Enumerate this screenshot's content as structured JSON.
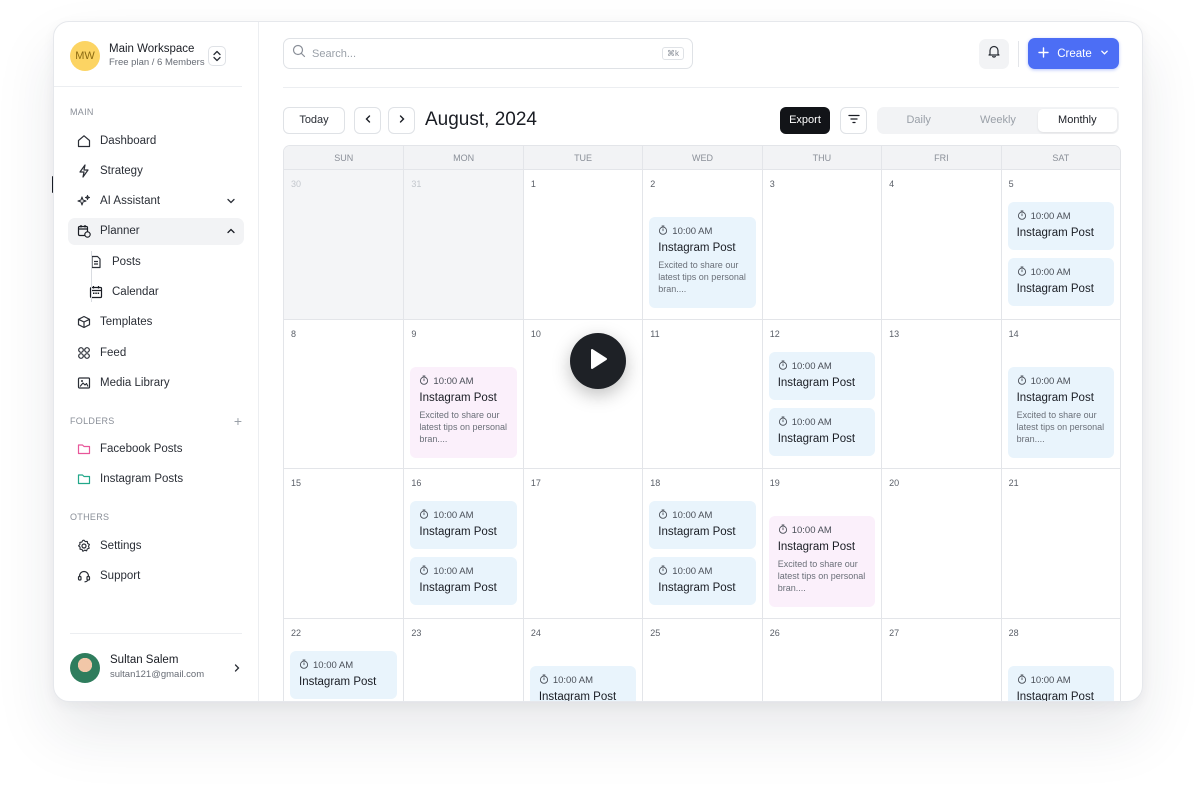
{
  "workspace": {
    "initials": "MW",
    "name": "Main Workspace",
    "plan": "Free plan / 6 Members"
  },
  "sidebar": {
    "main_label": "MAIN",
    "items": [
      {
        "label": "Dashboard",
        "icon": "home-icon"
      },
      {
        "label": "Strategy",
        "icon": "bolt-icon"
      },
      {
        "label": "AI Assistant",
        "icon": "sparkle-icon"
      },
      {
        "label": "Planner",
        "icon": "calendar-clock-icon"
      },
      {
        "label": "Posts",
        "icon": "document-icon"
      },
      {
        "label": "Calendar",
        "icon": "calendar-icon"
      },
      {
        "label": "Templates",
        "icon": "cube-icon"
      },
      {
        "label": "Feed",
        "icon": "grid-circles-icon"
      },
      {
        "label": "Media Library",
        "icon": "image-icon"
      }
    ],
    "folders_label": "FOLDERS",
    "folders": [
      {
        "label": "Facebook Posts",
        "color": "#e8569a"
      },
      {
        "label": "Instagram Posts",
        "color": "#22a88a"
      }
    ],
    "others_label": "OTHERS",
    "others": [
      {
        "label": "Settings",
        "icon": "gear-icon"
      },
      {
        "label": "Support",
        "icon": "headset-icon"
      }
    ]
  },
  "user": {
    "name": "Sultan Salem",
    "email": "sultan121@gmail.com"
  },
  "topbar": {
    "search_placeholder": "Search...",
    "shortcut": "⌘k",
    "create_label": "Create",
    "accent": "#4c6ef5"
  },
  "toolbar": {
    "today": "Today",
    "month": "August, 2024",
    "export": "Export",
    "views": [
      "Daily",
      "Weekly",
      "Monthly"
    ],
    "active_view": "Monthly"
  },
  "calendar": {
    "weekdays": [
      "SUN",
      "MON",
      "TUE",
      "WED",
      "THU",
      "FRI",
      "SAT"
    ],
    "event_time": "10:00 AM",
    "event_title": "Instagram Post",
    "event_desc": "Excited to share our latest tips on personal bran....",
    "weeks": [
      [
        "30",
        "31",
        "1",
        "2",
        "3",
        "4",
        "5"
      ],
      [
        "8",
        "9",
        "10",
        "11",
        "12",
        "13",
        "14"
      ],
      [
        "15",
        "16",
        "17",
        "18",
        "19",
        "20",
        "21"
      ],
      [
        "22",
        "23",
        "24",
        "25",
        "26",
        "27",
        "28"
      ]
    ]
  }
}
